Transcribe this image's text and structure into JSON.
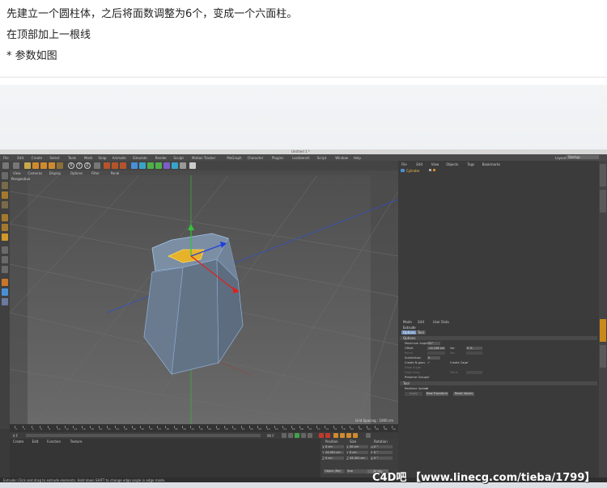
{
  "article": {
    "line1": "先建立一个圆柱体，之后将面数调整为6个，变成一个六面柱。",
    "line2": "在顶部加上一根线",
    "line3": "* 参数如图"
  },
  "c4d": {
    "window_title": "Untitled 1 *",
    "menu": [
      "File",
      "Edit",
      "Create",
      "Select",
      "Tools",
      "Mesh",
      "Snap",
      "Animate",
      "Simulate",
      "Render",
      "Sculpt",
      "Motion Tracker",
      "MoGraph",
      "Character",
      "Plugins",
      "Lockbench",
      "Script",
      "Window",
      "Help"
    ],
    "layout_label": "Layout:",
    "layout_value": "Startup",
    "viewport_menu": [
      "View",
      "Cameras",
      "Display",
      "Options",
      "Filter",
      "Panel"
    ],
    "viewport_label": "Perspective",
    "grid_spacing": "Grid Spacing : 1000 cm",
    "object_manager_menu": [
      "File",
      "Edit",
      "View",
      "Objects",
      "Tags",
      "Bookmarks"
    ],
    "object_name": "Cylinder",
    "attribute_menu": [
      "Mode",
      "Edit",
      "User Data"
    ],
    "attribute_title": "Extrude",
    "attribute_tabs": [
      "Options",
      "Tool"
    ],
    "options_section": "Options",
    "tool_section": "Tool",
    "attributes": {
      "max_angle_label": "Maximum Angle",
      "max_angle_value": "91°",
      "offset_label": "Offset",
      "offset_value": "-14.138 cm",
      "var_label": "Var.",
      "var_value": "0 %",
      "bevel_label": "Bevel",
      "var2_label": "Var.",
      "subdivision_label": "Subdivision",
      "subdivision_value": "0",
      "create_ngons_label": "Create N-gons",
      "create_caps_label": "Create Caps",
      "edge_angle_label": "Edge Angle",
      "edge_snap_label": "Edge Snap",
      "value_label": "Value",
      "preserve_groups_label": "Preserve Groups"
    },
    "realtime_update_label": "Realtime Update",
    "tool_buttons": [
      "Apply",
      "New Transform",
      "Reset Values"
    ],
    "coord_headers": [
      "Position",
      "Size",
      "Rotation"
    ],
    "coord_rows": [
      [
        "X",
        "0 cm",
        "X",
        "50 cm",
        "H",
        "0 °"
      ],
      [
        "Y",
        "24.001 cm",
        "Y",
        "0 cm",
        "P",
        "0 °"
      ],
      [
        "Z",
        "0 cm",
        "Z",
        "43.301 cm",
        "B",
        "0 °"
      ]
    ],
    "coord_mode": "Object (Rel)",
    "coord_size_mode": "Size",
    "apply_label": "Apply",
    "material_menu": [
      "Create",
      "Edit",
      "Function",
      "Texture"
    ],
    "timeline_labels": [
      "0",
      "2",
      "4",
      "6",
      "8",
      "10",
      "12",
      "14",
      "16",
      "18",
      "20",
      "22",
      "24",
      "26",
      "28",
      "30",
      "32",
      "34",
      "36",
      "38",
      "40",
      "42",
      "44",
      "46",
      "48",
      "50",
      "52",
      "54",
      "56",
      "58",
      "60",
      "62",
      "64",
      "66",
      "68",
      "70",
      "72",
      "74",
      "76",
      "78",
      "80",
      "82",
      "84",
      "86",
      "88",
      "90"
    ],
    "frame_start": "0 F",
    "frame_end": "90 F",
    "status_text": "Extrude: Click and drag to extrude elements. Hold down SHIFT to change edge angle in edge mode."
  },
  "watermark": "C4D吧 【www.linecg.com/tieba/1799】",
  "colors": {
    "viewport": "#5a5a5a",
    "selection": "#f3c14b",
    "axis_x": "#e0201b",
    "axis_y": "#36c23a",
    "axis_z": "#1f3ee0"
  }
}
